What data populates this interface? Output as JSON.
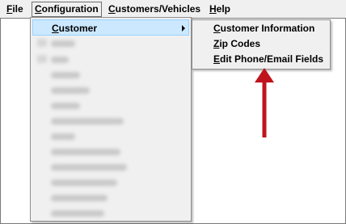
{
  "menubar": {
    "items": [
      {
        "hotkey": "F",
        "rest": "ile"
      },
      {
        "hotkey": "C",
        "rest": "onfiguration"
      },
      {
        "hotkey": "C",
        "rest": "ustomers/Vehicles"
      },
      {
        "hotkey": "H",
        "rest": "elp"
      }
    ]
  },
  "configuration_menu": {
    "active_item": {
      "hotkey": "C",
      "rest": "ustomer"
    }
  },
  "customer_submenu": {
    "items": [
      {
        "hotkey": "C",
        "rest": "ustomer Information"
      },
      {
        "hotkey": "Z",
        "rest": "ip Codes"
      },
      {
        "hotkey": "E",
        "rest": "dit Phone/Email Fields"
      }
    ]
  },
  "annotation": {
    "color": "#c0141c"
  }
}
